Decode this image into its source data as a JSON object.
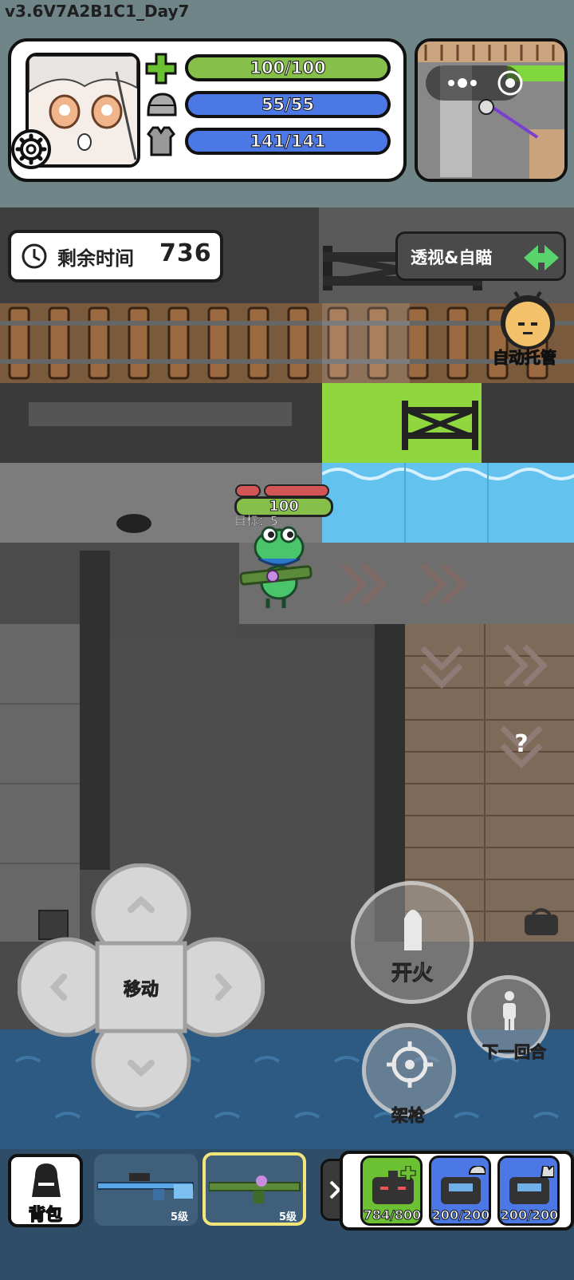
{
  "version": "v3.6V7A2B1C1_Day7",
  "stats": {
    "health": "100/100",
    "helmet": "55/55",
    "armor": "141/141"
  },
  "timer": {
    "label": "剩余时间",
    "value": "736"
  },
  "xray_button": "透视&自瞄",
  "auto_label": "自动托管",
  "player": {
    "hp": "100",
    "target": "目标：5"
  },
  "controls": {
    "move": "移动",
    "fire": "开火",
    "next_round": "下一回合",
    "aim": "架枪"
  },
  "bottom": {
    "backpack": "背包",
    "weapon1_level": "5级",
    "weapon2_level": "5级",
    "medkit_count": "784/800",
    "helmet_count": "200/200",
    "armor_count": "200/200"
  },
  "colors": {
    "health_bar": "#86bf4a",
    "shield_bar": "#4b78e5",
    "selected_slot": "#f2e57a",
    "water": "#64c2ee",
    "grass": "#8fd63f"
  }
}
